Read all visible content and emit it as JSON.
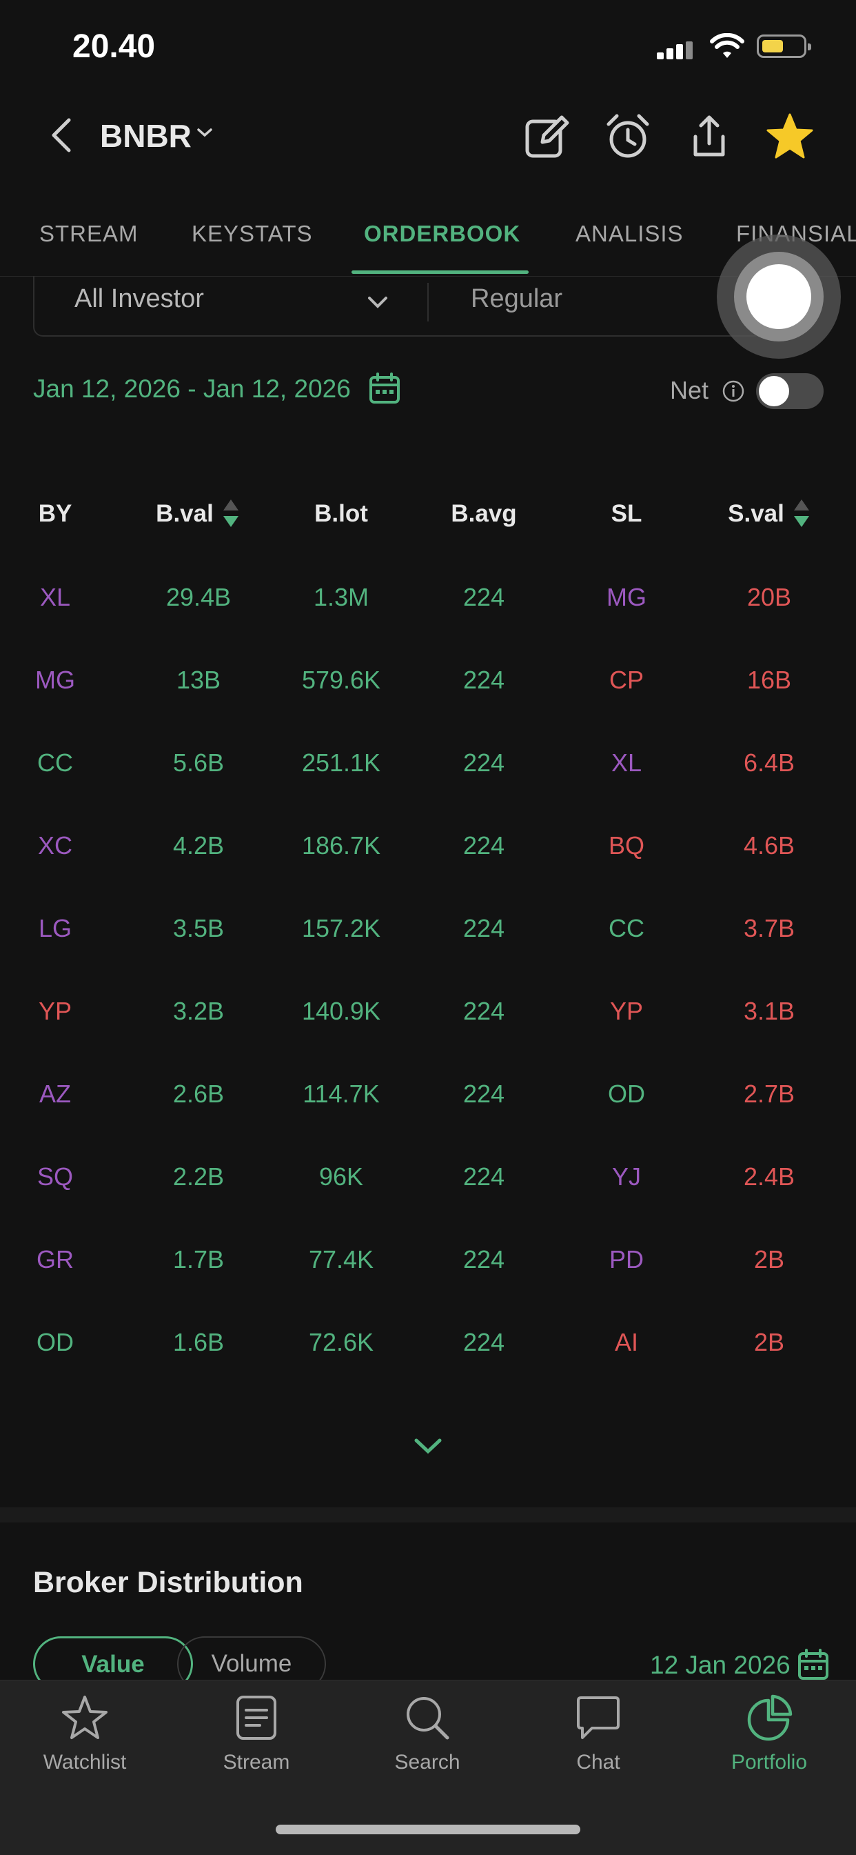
{
  "status_bar": {
    "time": "20.40"
  },
  "header": {
    "ticker": "BNBR"
  },
  "tabs": [
    {
      "label": "STREAM"
    },
    {
      "label": "KEYSTATS"
    },
    {
      "label": "ORDERBOOK"
    },
    {
      "label": "ANALISIS"
    },
    {
      "label": "FINANSIAL"
    }
  ],
  "filters": {
    "investor": "All Investor",
    "board": "Regular"
  },
  "date_range": "Jan 12, 2026 - Jan 12, 2026",
  "net": {
    "label": "Net",
    "enabled": false
  },
  "table": {
    "headers": [
      "BY",
      "B.val",
      "B.lot",
      "B.avg",
      "SL",
      "S.val"
    ],
    "rows": [
      {
        "buyer": "XL",
        "buyer_color": "#9c59c0",
        "bval": "29.4B",
        "blot": "1.3M",
        "bavg": "224",
        "seller": "MG",
        "seller_color": "#9c59c0",
        "sval": "20B"
      },
      {
        "buyer": "MG",
        "buyer_color": "#9c59c0",
        "bval": "13B",
        "blot": "579.6K",
        "bavg": "224",
        "seller": "CP",
        "seller_color": "#e05656",
        "sval": "16B"
      },
      {
        "buyer": "CC",
        "buyer_color": "#52b37f",
        "bval": "5.6B",
        "blot": "251.1K",
        "bavg": "224",
        "seller": "XL",
        "seller_color": "#9c59c0",
        "sval": "6.4B"
      },
      {
        "buyer": "XC",
        "buyer_color": "#9c59c0",
        "bval": "4.2B",
        "blot": "186.7K",
        "bavg": "224",
        "seller": "BQ",
        "seller_color": "#e05656",
        "sval": "4.6B"
      },
      {
        "buyer": "LG",
        "buyer_color": "#9c59c0",
        "bval": "3.5B",
        "blot": "157.2K",
        "bavg": "224",
        "seller": "CC",
        "seller_color": "#52b37f",
        "sval": "3.7B"
      },
      {
        "buyer": "YP",
        "buyer_color": "#e05656",
        "bval": "3.2B",
        "blot": "140.9K",
        "bavg": "224",
        "seller": "YP",
        "seller_color": "#e05656",
        "sval": "3.1B"
      },
      {
        "buyer": "AZ",
        "buyer_color": "#9c59c0",
        "bval": "2.6B",
        "blot": "114.7K",
        "bavg": "224",
        "seller": "OD",
        "seller_color": "#52b37f",
        "sval": "2.7B"
      },
      {
        "buyer": "SQ",
        "buyer_color": "#9c59c0",
        "bval": "2.2B",
        "blot": "96K",
        "bavg": "224",
        "seller": "YJ",
        "seller_color": "#9c59c0",
        "sval": "2.4B"
      },
      {
        "buyer": "GR",
        "buyer_color": "#9c59c0",
        "bval": "1.7B",
        "blot": "77.4K",
        "bavg": "224",
        "seller": "PD",
        "seller_color": "#9c59c0",
        "sval": "2B"
      },
      {
        "buyer": "OD",
        "buyer_color": "#52b37f",
        "bval": "1.6B",
        "blot": "72.6K",
        "bavg": "224",
        "seller": "AI",
        "seller_color": "#e05656",
        "sval": "2B"
      }
    ]
  },
  "broker_distribution": {
    "title": "Broker Distribution",
    "toggle": [
      "Value",
      "Volume"
    ],
    "date": "12 Jan 2026"
  },
  "bottom_nav": [
    {
      "label": "Watchlist",
      "icon": "star-outline-icon"
    },
    {
      "label": "Stream",
      "icon": "document-icon"
    },
    {
      "label": "Search",
      "icon": "search-icon"
    },
    {
      "label": "Chat",
      "icon": "chat-bubble-icon"
    },
    {
      "label": "Portfolio",
      "icon": "pie-chart-icon"
    }
  ],
  "colors": {
    "accent": "#52b37f",
    "sell": "#e05656",
    "broker_purple": "#9c59c0",
    "star": "#f6c928"
  }
}
